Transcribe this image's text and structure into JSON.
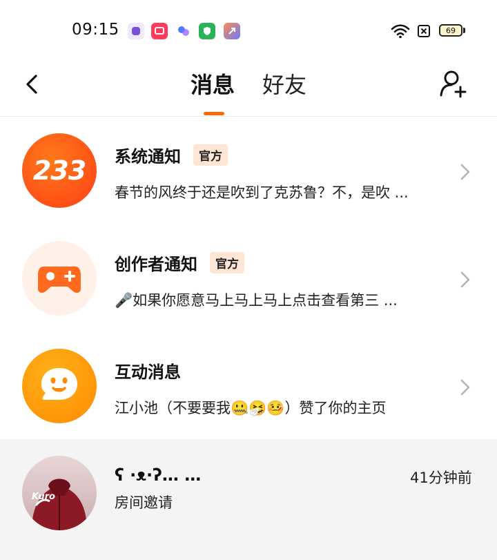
{
  "status_bar": {
    "time": "09:15",
    "battery": "69",
    "app_icons": [
      "chat-app-icon",
      "video-app-icon",
      "circles-app-icon",
      "shield-app-icon",
      "shortcut-app-icon"
    ]
  },
  "header": {
    "tabs": [
      {
        "label": "消息",
        "active": true
      },
      {
        "label": "好友",
        "active": false
      }
    ],
    "accent": "#ff6a00"
  },
  "messages": [
    {
      "title": "系统通知",
      "badge": "官方",
      "subtitle": "春节的风终于还是吹到了克苏鲁？不，是吹 ...",
      "avatar_text": "233",
      "avatar_icon": "logo-233-icon"
    },
    {
      "title": "创作者通知",
      "badge": "官方",
      "subtitle": "🎤如果你愿意马上马上马上点击查看第三 ...",
      "avatar_icon": "gamepad-icon"
    },
    {
      "title": "互动消息",
      "badge": "",
      "subtitle": "江小池（不要要我🤐🤧🤒）赞了你的主页",
      "avatar_icon": "chat-bubble-face-icon"
    }
  ],
  "friend_message": {
    "name": "ʕ ·ᴥ·ʔ… …",
    "subtitle": "房间邀请",
    "time_ago": "41分钟前",
    "avatar_text": "Kuro"
  }
}
